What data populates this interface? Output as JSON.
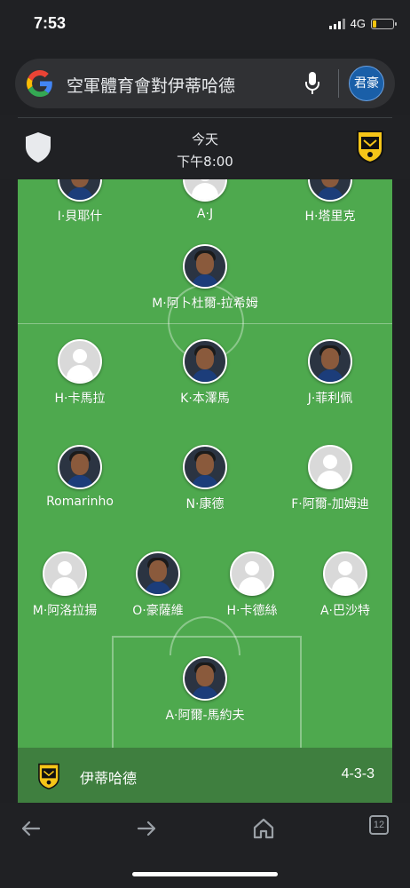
{
  "status_bar": {
    "time": "7:53",
    "network": "4G"
  },
  "search": {
    "query": "空軍體育會對伊蒂哈德",
    "user_initials": "君豪"
  },
  "match": {
    "date": "今天",
    "kickoff": "下午8:00"
  },
  "team": {
    "name": "伊蒂哈德",
    "formation": "4-3-3"
  },
  "players": [
    {
      "name": "I·貝耶什",
      "photo": true
    },
    {
      "name": "A·J",
      "photo": false
    },
    {
      "name": "H·塔里克",
      "photo": true
    },
    {
      "name": "M·阿卜杜爾-拉希姆",
      "photo": true
    },
    {
      "name": "H·卡馬拉",
      "photo": false
    },
    {
      "name": "K·本澤馬",
      "photo": true
    },
    {
      "name": "J·菲利佩",
      "photo": true
    },
    {
      "name": "Romarinho",
      "photo": true
    },
    {
      "name": "N·康德",
      "photo": true
    },
    {
      "name": "F·阿爾-加姆迪",
      "photo": false
    },
    {
      "name": "M·阿洛拉揚",
      "photo": false
    },
    {
      "name": "O·豪薩維",
      "photo": true
    },
    {
      "name": "H·卡德絲",
      "photo": false
    },
    {
      "name": "A·巴沙特",
      "photo": false
    },
    {
      "name": "A·阿爾-馬約夫",
      "photo": true
    }
  ],
  "nav": {
    "tab_count": "12"
  },
  "colors": {
    "pitch": "#4ea94e",
    "team_bar": "#3f7f3f",
    "background": "#202124"
  }
}
